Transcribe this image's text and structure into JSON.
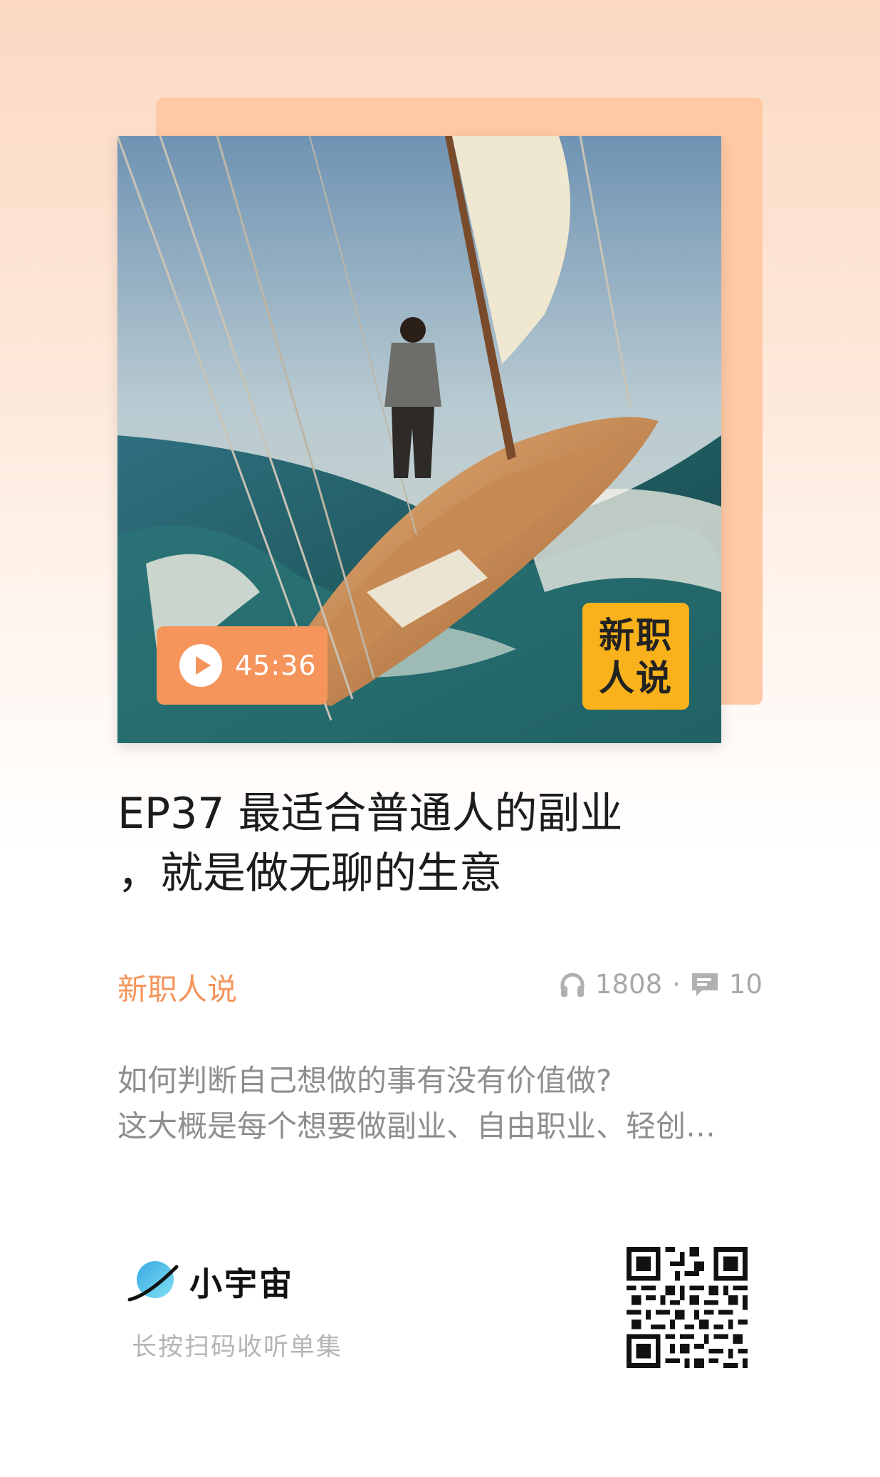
{
  "episode": {
    "duration": "45:36",
    "title_line1": "EP37 最适合普通人的副业",
    "title_line2": "，就是做无聊的生意",
    "channel": "新职人说",
    "listens": "1808",
    "separator": "·",
    "comments": "10",
    "description_line1": "如何判断自己想做的事有没有价值做?",
    "description_line2": "这大概是每个想要做副业、自由职业、轻创…"
  },
  "cover_badge": {
    "line1": "新职",
    "line2": "人说"
  },
  "brand": {
    "name": "小宇宙",
    "hint": "长按扫码收听单集"
  },
  "icons": {
    "play": "play-icon",
    "listens": "headphones-icon",
    "comments": "comment-icon",
    "logo": "planet-icon",
    "qr": "qr-code"
  },
  "colors": {
    "accent": "#f5955c",
    "badge": "#f9b21c",
    "backcard": "#ffc9a6"
  }
}
